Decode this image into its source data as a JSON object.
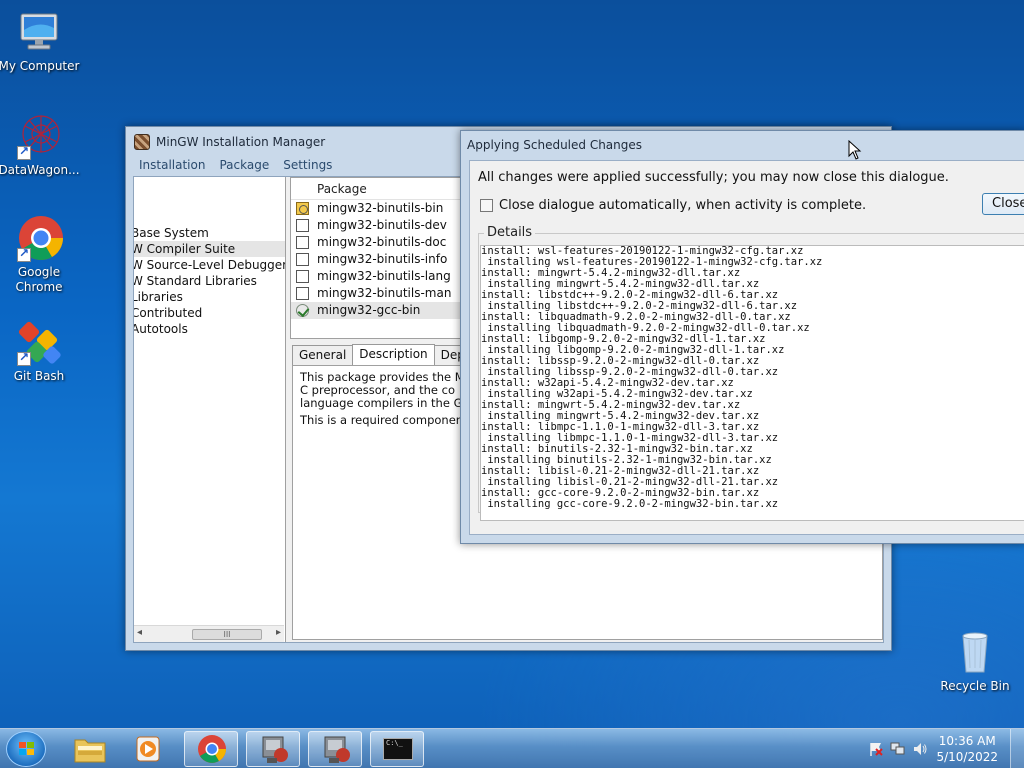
{
  "desktop": {
    "icons": [
      {
        "label": "My Computer"
      },
      {
        "label": "DataWagon..."
      },
      {
        "label": "Google Chrome"
      },
      {
        "label": "Git Bash"
      },
      {
        "label": "Recycle Bin"
      }
    ]
  },
  "manager": {
    "title": "MinGW Installation Manager",
    "menu": [
      "Installation",
      "Package",
      "Settings"
    ],
    "tree": [
      "Base System",
      "W Compiler Suite",
      "W Source-Level Debugger",
      "W Standard Libraries",
      "Libraries",
      "Contributed",
      "Autotools"
    ],
    "package_header": "Package",
    "packages": [
      "mingw32-binutils-bin",
      "mingw32-binutils-dev",
      "mingw32-binutils-doc",
      "mingw32-binutils-info",
      "mingw32-binutils-lang",
      "mingw32-binutils-man",
      "mingw32-gcc-bin"
    ],
    "tabs": [
      "General",
      "Description",
      "Depe"
    ],
    "description": [
      "This package provides the M",
      "C preprocessor, and the co",
      "language compilers in the GI"
    ],
    "description2": "This is a required componen",
    "scroll_grip": "III"
  },
  "dialog": {
    "title": "Applying Scheduled Changes",
    "message": "All changes were applied successfully; you may now close this dialogue.",
    "checkbox_label": "Close dialogue automatically, when activity is complete.",
    "close_label": "Close",
    "details_label": "Details",
    "log": [
      "install: wsl-features-20190122-1-mingw32-cfg.tar.xz",
      " installing wsl-features-20190122-1-mingw32-cfg.tar.xz",
      "install: mingwrt-5.4.2-mingw32-dll.tar.xz",
      " installing mingwrt-5.4.2-mingw32-dll.tar.xz",
      "install: libstdc++-9.2.0-2-mingw32-dll-6.tar.xz",
      " installing libstdc++-9.2.0-2-mingw32-dll-6.tar.xz",
      "install: libquadmath-9.2.0-2-mingw32-dll-0.tar.xz",
      " installing libquadmath-9.2.0-2-mingw32-dll-0.tar.xz",
      "install: libgomp-9.2.0-2-mingw32-dll-1.tar.xz",
      " installing libgomp-9.2.0-2-mingw32-dll-1.tar.xz",
      "install: libssp-9.2.0-2-mingw32-dll-0.tar.xz",
      " installing libssp-9.2.0-2-mingw32-dll-0.tar.xz",
      "install: w32api-5.4.2-mingw32-dev.tar.xz",
      " installing w32api-5.4.2-mingw32-dev.tar.xz",
      "install: mingwrt-5.4.2-mingw32-dev.tar.xz",
      " installing mingwrt-5.4.2-mingw32-dev.tar.xz",
      "install: libmpc-1.1.0-1-mingw32-dll-3.tar.xz",
      " installing libmpc-1.1.0-1-mingw32-dll-3.tar.xz",
      "install: binutils-2.32-1-mingw32-bin.tar.xz",
      " installing binutils-2.32-1-mingw32-bin.tar.xz",
      "install: libisl-0.21-2-mingw32-dll-21.tar.xz",
      " installing libisl-0.21-2-mingw32-dll-21.tar.xz",
      "install: gcc-core-9.2.0-2-mingw32-bin.tar.xz",
      " installing gcc-core-9.2.0-2-mingw32-bin.tar.xz"
    ]
  },
  "taskbar": {
    "time": "10:36 AM",
    "date": "5/10/2022",
    "console_prompt": "C:\\_"
  }
}
